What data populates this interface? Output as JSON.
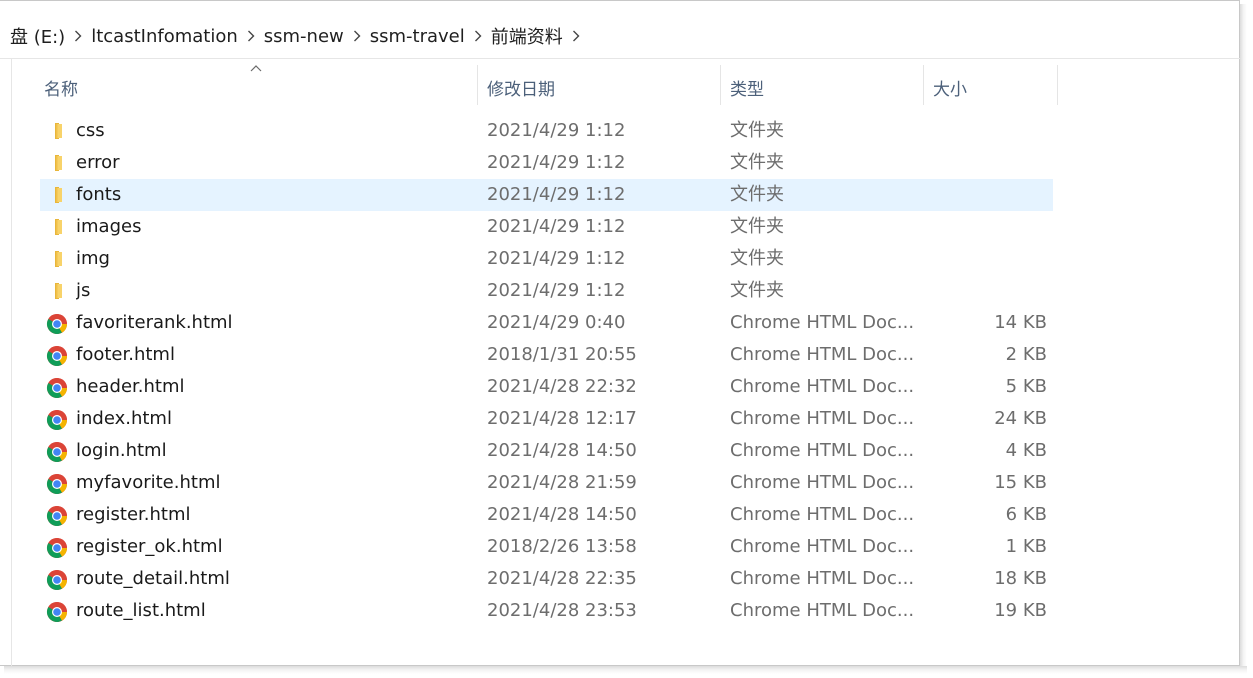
{
  "breadcrumb": {
    "segments": [
      "盘 (E:)",
      "ltcastInfomation",
      "ssm-new",
      "ssm-travel",
      "前端资料"
    ]
  },
  "columns": {
    "name": "名称",
    "date": "修改日期",
    "type": "类型",
    "size": "大小"
  },
  "colors": {
    "selected_row": "#e5f3ff",
    "header_text": "#4c607a",
    "folder_yellow": "#f4c542"
  },
  "files": [
    {
      "name": "css",
      "date": "2021/4/29 1:12",
      "type": "文件夹",
      "size": "",
      "icon": "folder-icon",
      "selected": false
    },
    {
      "name": "error",
      "date": "2021/4/29 1:12",
      "type": "文件夹",
      "size": "",
      "icon": "folder-icon",
      "selected": false
    },
    {
      "name": "fonts",
      "date": "2021/4/29 1:12",
      "type": "文件夹",
      "size": "",
      "icon": "folder-icon",
      "selected": true
    },
    {
      "name": "images",
      "date": "2021/4/29 1:12",
      "type": "文件夹",
      "size": "",
      "icon": "folder-icon",
      "selected": false
    },
    {
      "name": "img",
      "date": "2021/4/29 1:12",
      "type": "文件夹",
      "size": "",
      "icon": "folder-icon",
      "selected": false
    },
    {
      "name": "js",
      "date": "2021/4/29 1:12",
      "type": "文件夹",
      "size": "",
      "icon": "folder-icon",
      "selected": false
    },
    {
      "name": "favoriterank.html",
      "date": "2021/4/29 0:40",
      "type": "Chrome HTML Doc...",
      "size": "14 KB",
      "icon": "chrome-icon",
      "selected": false
    },
    {
      "name": "footer.html",
      "date": "2018/1/31 20:55",
      "type": "Chrome HTML Doc...",
      "size": "2 KB",
      "icon": "chrome-icon",
      "selected": false
    },
    {
      "name": "header.html",
      "date": "2021/4/28 22:32",
      "type": "Chrome HTML Doc...",
      "size": "5 KB",
      "icon": "chrome-icon",
      "selected": false
    },
    {
      "name": "index.html",
      "date": "2021/4/28 12:17",
      "type": "Chrome HTML Doc...",
      "size": "24 KB",
      "icon": "chrome-icon",
      "selected": false
    },
    {
      "name": "login.html",
      "date": "2021/4/28 14:50",
      "type": "Chrome HTML Doc...",
      "size": "4 KB",
      "icon": "chrome-icon",
      "selected": false
    },
    {
      "name": "myfavorite.html",
      "date": "2021/4/28 21:59",
      "type": "Chrome HTML Doc...",
      "size": "15 KB",
      "icon": "chrome-icon",
      "selected": false
    },
    {
      "name": "register.html",
      "date": "2021/4/28 14:50",
      "type": "Chrome HTML Doc...",
      "size": "6 KB",
      "icon": "chrome-icon",
      "selected": false
    },
    {
      "name": "register_ok.html",
      "date": "2018/2/26 13:58",
      "type": "Chrome HTML Doc...",
      "size": "1 KB",
      "icon": "chrome-icon",
      "selected": false
    },
    {
      "name": "route_detail.html",
      "date": "2021/4/28 22:35",
      "type": "Chrome HTML Doc...",
      "size": "18 KB",
      "icon": "chrome-icon",
      "selected": false
    },
    {
      "name": "route_list.html",
      "date": "2021/4/28 23:53",
      "type": "Chrome HTML Doc...",
      "size": "19 KB",
      "icon": "chrome-icon",
      "selected": false
    }
  ]
}
